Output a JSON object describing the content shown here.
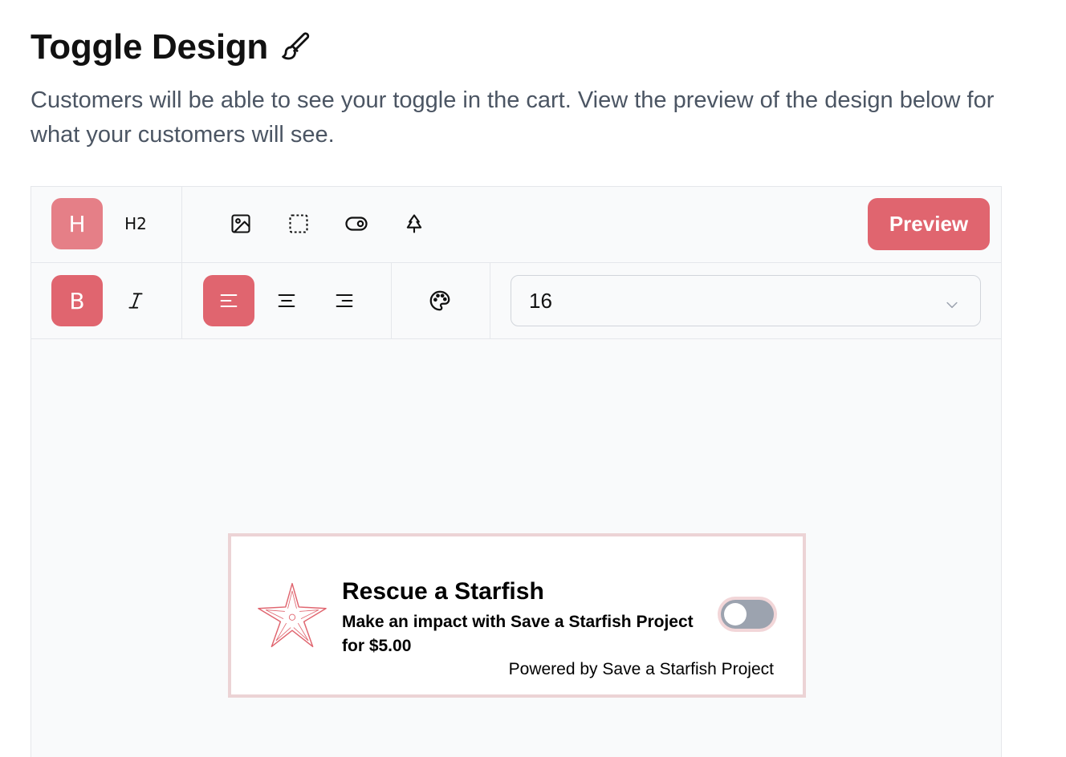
{
  "page": {
    "title": "Toggle Design",
    "description": "Customers will be able to see your toggle in the cart. View the preview of the design below for what your customers will see."
  },
  "toolbar": {
    "heading_label": "H",
    "heading2_label": "H2",
    "bold_label": "B",
    "preview_label": "Preview",
    "font_size": "16",
    "icons": [
      "image-icon",
      "border-icon",
      "toggle-icon",
      "tree-icon",
      "italic-icon",
      "align-left-icon",
      "align-center-icon",
      "align-right-icon",
      "palette-icon",
      "chevron-down-icon"
    ],
    "active_states": {
      "heading": true,
      "bold": true,
      "align_left": true
    },
    "accent_color": "#e0656f"
  },
  "widget": {
    "title": "Rescue a Starfish",
    "subtitle": "Make an impact with Save a Starfish Project for $5.00",
    "powered_by": "Powered by Save a Starfish Project",
    "toggle_on": false,
    "border_color": "#ecd3d5",
    "icon": "starfish-icon"
  }
}
